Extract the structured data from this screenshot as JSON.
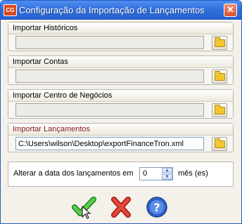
{
  "window": {
    "app_icon_text": "CG",
    "title": "Configuração da Importação de Lançamentos",
    "close_glyph": "✕"
  },
  "panels": [
    {
      "label": "Importar Históricos",
      "value": "",
      "highlight": false
    },
    {
      "label": "Importar Contas",
      "value": "",
      "highlight": false
    },
    {
      "label": "Importar Centro de Negócios",
      "value": "",
      "highlight": false
    },
    {
      "label": "Importar Lançamentos",
      "value": "C:\\Users\\wilson\\Desktop\\exportFinanceTron.xml",
      "highlight": true
    }
  ],
  "date_shift": {
    "label": "Alterar a data dos lançamentos em",
    "value": "0",
    "unit": "mês (es)"
  },
  "buttons": [
    {
      "name": "confirm",
      "icon": "green-check-icon"
    },
    {
      "name": "cancel",
      "icon": "red-x-icon"
    },
    {
      "name": "help",
      "icon": "help-icon"
    }
  ],
  "colors": {
    "titlebar": "#2f6fdc",
    "highlight_label": "#8b1c1c",
    "confirm": "#3aa13a",
    "cancel": "#d9342b",
    "help": "#2f63c9"
  }
}
